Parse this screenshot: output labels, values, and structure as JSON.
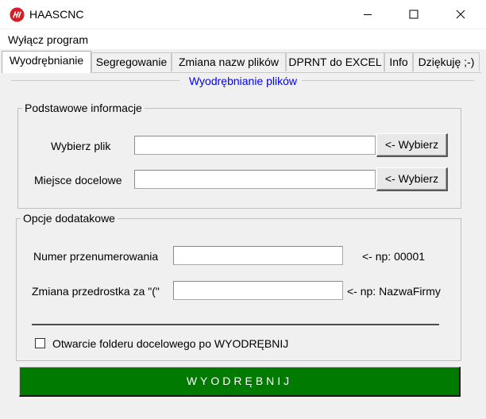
{
  "window": {
    "title": "HAASCNC",
    "icon": "haas-logo-icon",
    "controls": [
      "minimize-icon",
      "maximize-icon",
      "close-icon"
    ]
  },
  "menu": {
    "items": [
      "Wyłącz program"
    ]
  },
  "tabs": [
    {
      "label": "Wyodrębnianie",
      "active": true
    },
    {
      "label": "Segregowanie",
      "active": false
    },
    {
      "label": "Zmiana nazw plików",
      "active": false
    },
    {
      "label": "DPRNT do EXCEL",
      "active": false
    },
    {
      "label": "Info",
      "active": false
    },
    {
      "label": "Dziękuję ;-)",
      "active": false
    }
  ],
  "panel": {
    "title": "Wyodrębnianie plików",
    "title_color": "#0000ff"
  },
  "basic_info": {
    "legend": "Podstawowe informacje",
    "file_label": "Wybierz plik",
    "file_value": "",
    "file_button": "<- Wybierz",
    "dest_label": "Miejsce docelowe",
    "dest_value": "",
    "dest_button": "<- Wybierz"
  },
  "extra_options": {
    "legend": "Opcje dodatakowe",
    "renumber_label": "Numer przenumerowania",
    "renumber_value": "",
    "renumber_hint": "<- np: 00001",
    "prefix_label": "Zmiana przedrostka za \"(\"",
    "prefix_value": "",
    "prefix_hint": "<- np: NazwaFirmy",
    "open_folder_label": "Otwarcie folderu docelowego po WYODRĘBNIJ",
    "open_folder_checked": false
  },
  "action": {
    "label": "WYODRĘBNIJ",
    "color": "#007a00"
  }
}
